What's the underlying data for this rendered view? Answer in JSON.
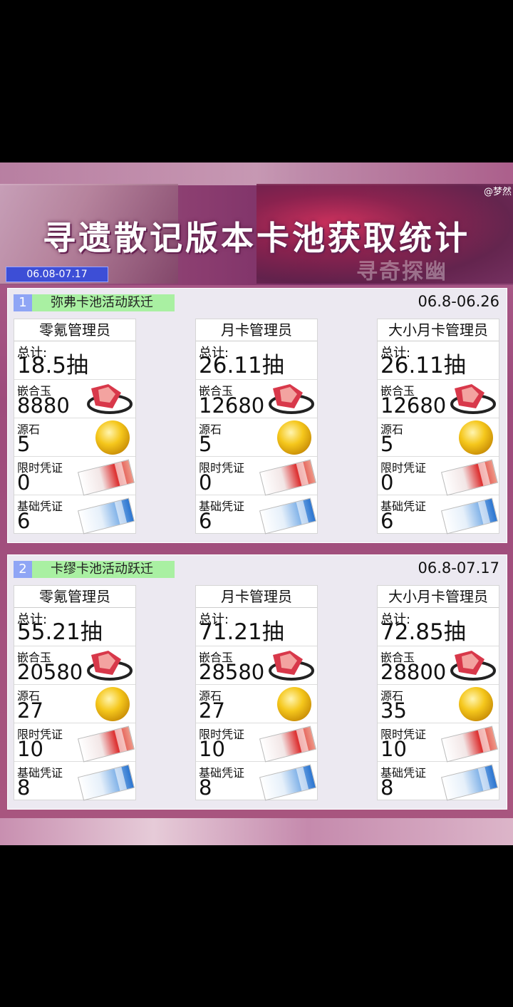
{
  "header": {
    "title": "寻遗散记版本卡池获取统计",
    "watermark": "@梦然",
    "art_text": "寻奇探幽",
    "period": "06.08-07.17"
  },
  "pools": [
    {
      "index": "1",
      "name": "弥弗卡池活动跃迁",
      "date_range": "06.8-06.26",
      "cards": [
        {
          "role": "零氪管理员",
          "total_label": "总计:",
          "total": "18.5抽",
          "gem_label": "嵌合玉",
          "gem": "8880",
          "stone_label": "源石",
          "stone": "5",
          "limited_label": "限时凭证",
          "limited": "0",
          "basic_label": "基础凭证",
          "basic": "6"
        },
        {
          "role": "月卡管理员",
          "total_label": "总计:",
          "total": "26.11抽",
          "gem_label": "嵌合玉",
          "gem": "12680",
          "stone_label": "源石",
          "stone": "5",
          "limited_label": "限时凭证",
          "limited": "0",
          "basic_label": "基础凭证",
          "basic": "6"
        },
        {
          "role": "大小月卡管理员",
          "total_label": "总计:",
          "total": "26.11抽",
          "gem_label": "嵌合玉",
          "gem": "12680",
          "stone_label": "源石",
          "stone": "5",
          "limited_label": "限时凭证",
          "limited": "0",
          "basic_label": "基础凭证",
          "basic": "6"
        }
      ]
    },
    {
      "index": "2",
      "name": "卡缪卡池活动跃迁",
      "date_range": "06.8-07.17",
      "cards": [
        {
          "role": "零氪管理员",
          "total_label": "总计:",
          "total": "55.21抽",
          "gem_label": "嵌合玉",
          "gem": "20580",
          "stone_label": "源石",
          "stone": "27",
          "limited_label": "限时凭证",
          "limited": "10",
          "basic_label": "基础凭证",
          "basic": "8"
        },
        {
          "role": "月卡管理员",
          "total_label": "总计:",
          "total": "71.21抽",
          "gem_label": "嵌合玉",
          "gem": "28580",
          "stone_label": "源石",
          "stone": "27",
          "limited_label": "限时凭证",
          "limited": "10",
          "basic_label": "基础凭证",
          "basic": "8"
        },
        {
          "role": "大小月卡管理员",
          "total_label": "总计:",
          "total": "72.85抽",
          "gem_label": "嵌合玉",
          "gem": "28800",
          "stone_label": "源石",
          "stone": "35",
          "limited_label": "限时凭证",
          "limited": "10",
          "basic_label": "基础凭证",
          "basic": "8"
        }
      ]
    }
  ],
  "icons": {
    "gem": "red-crystal-gem-icon",
    "stone": "gold-orb-icon",
    "limited": "red-ticket-icon",
    "basic": "blue-ticket-icon"
  }
}
